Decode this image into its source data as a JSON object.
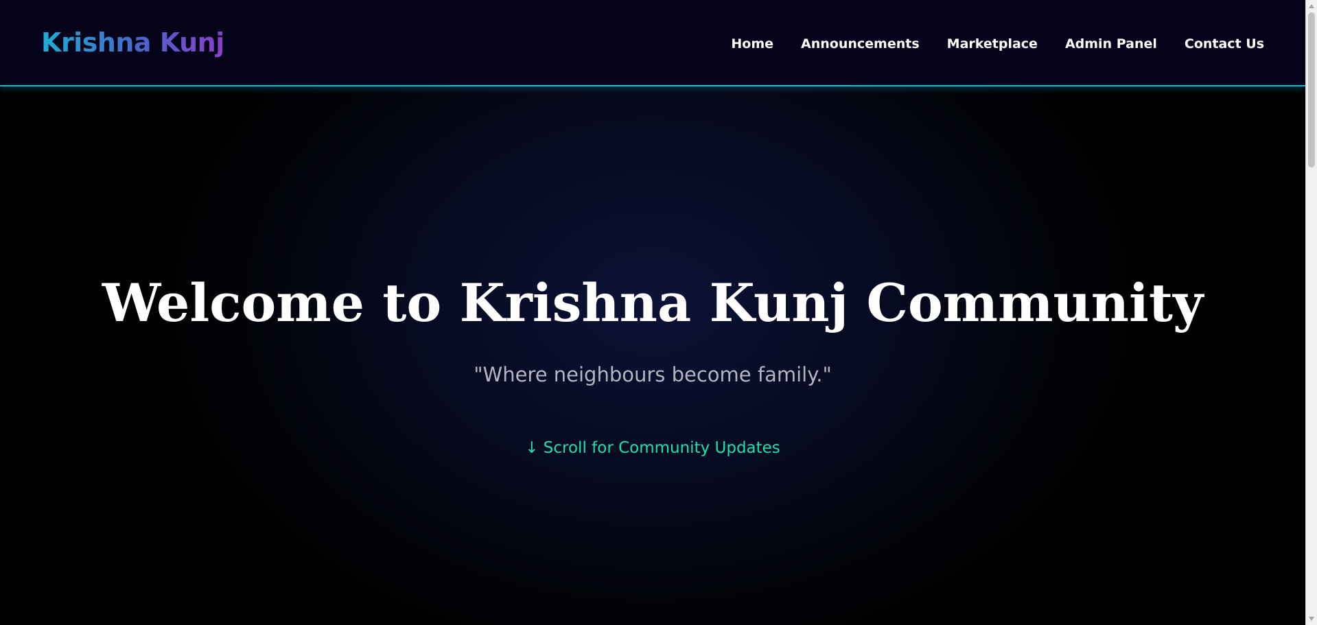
{
  "navbar": {
    "brand": "Krishna Kunj",
    "links": [
      {
        "label": "Home"
      },
      {
        "label": "Announcements"
      },
      {
        "label": "Marketplace"
      },
      {
        "label": "Admin Panel"
      },
      {
        "label": "Contact Us"
      }
    ]
  },
  "hero": {
    "title": "Welcome to Krishna Kunj Community",
    "subtitle": "\"Where neighbours become family.\"",
    "scroll_cta": "↓ Scroll for Community Updates"
  },
  "colors": {
    "navbar_bg": "#04031a",
    "navbar_border": "#1fb8d2",
    "brand_gradient_start": "#19b0d6",
    "brand_gradient_end": "#8a3fc8",
    "cta_accent": "#1fe0a8",
    "subtitle_text": "#b3b6c2"
  }
}
